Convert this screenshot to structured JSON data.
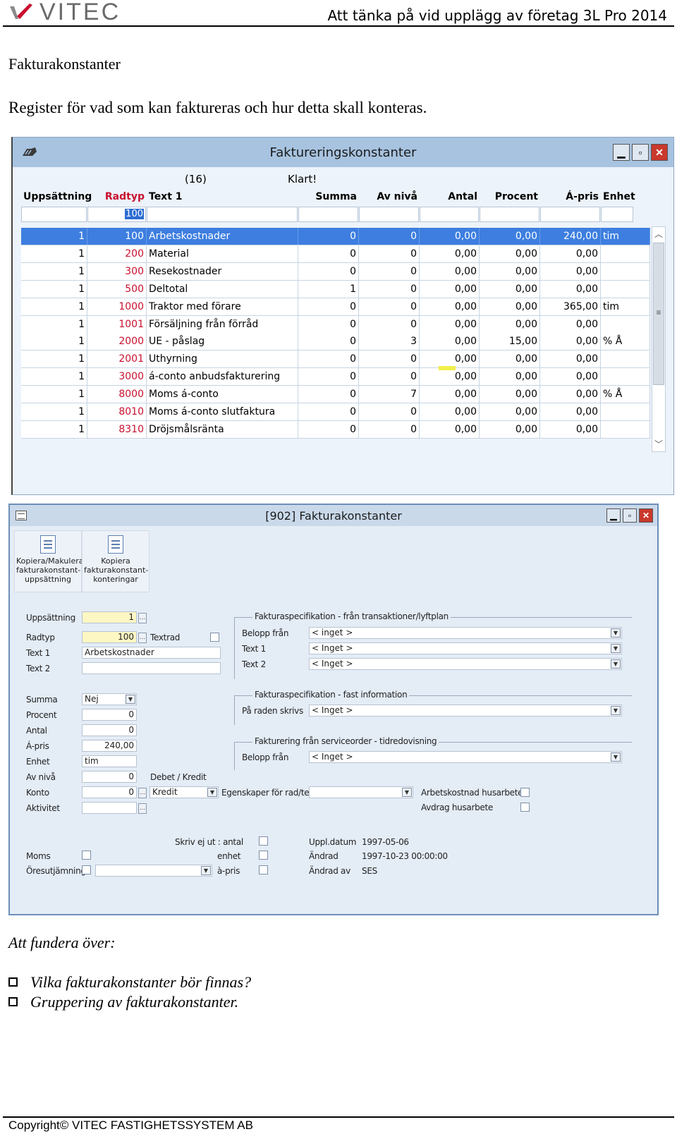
{
  "document": {
    "logo_text": "VITEC",
    "header_title": "Att tänka på vid upplägg av företag 3L Pro 2014",
    "section_title": "Fakturakonstanter",
    "section_description": "Register för vad som kan faktureras och hur detta skall konteras.",
    "ponder_heading": "Att fundera över:",
    "bullets": [
      "Vilka fakturakonstanter bör finnas?",
      "Gruppering av fakturakonstanter."
    ],
    "footer": "Copyright© VITEC FASTIGHETSSYSTEM AB"
  },
  "window1": {
    "title": "Faktureringskonstanter",
    "record_count": "(16)",
    "status": "Klart!",
    "columns": [
      "Uppsättning",
      "Radtyp",
      "Text 1",
      "Summa",
      "Av nivå",
      "Antal",
      "Procent",
      "Á-pris",
      "Enhet"
    ],
    "filter_value": "100",
    "rows": [
      [
        "1",
        "100",
        "Arbetskostnader",
        "0",
        "0",
        "0,00",
        "0,00",
        "240,00",
        "tim"
      ],
      [
        "1",
        "200",
        "Material",
        "0",
        "0",
        "0,00",
        "0,00",
        "0,00",
        ""
      ],
      [
        "1",
        "300",
        "Resekostnader",
        "0",
        "0",
        "0,00",
        "0,00",
        "0,00",
        ""
      ],
      [
        "1",
        "500",
        "Deltotal",
        "1",
        "0",
        "0,00",
        "0,00",
        "0,00",
        ""
      ],
      [
        "1",
        "1000",
        "Traktor med förare",
        "0",
        "0",
        "0,00",
        "0,00",
        "365,00",
        "tim"
      ],
      [
        "1",
        "1001",
        "Försäljning från förråd",
        "0",
        "0",
        "0,00",
        "0,00",
        "0,00",
        ""
      ],
      [
        "1",
        "2000",
        "UE - påslag",
        "0",
        "3",
        "0,00",
        "15,00",
        "0,00",
        "% Å"
      ],
      [
        "1",
        "2001",
        "Uthyrning",
        "0",
        "0",
        "0,00",
        "0,00",
        "0,00",
        ""
      ],
      [
        "1",
        "3000",
        "á-conto anbudsfakturering",
        "0",
        "0",
        "0,00",
        "0,00",
        "0,00",
        ""
      ],
      [
        "1",
        "8000",
        "Moms á-conto",
        "0",
        "7",
        "0,00",
        "0,00",
        "0,00",
        "% Å"
      ],
      [
        "1",
        "8010",
        "Moms á-conto slutfaktura",
        "0",
        "0",
        "0,00",
        "0,00",
        "0,00",
        ""
      ],
      [
        "1",
        "8310",
        "Dröjsmålsränta",
        "0",
        "0",
        "0,00",
        "0,00",
        "0,00",
        ""
      ]
    ]
  },
  "window2": {
    "title": "[902]  Fakturakonstanter",
    "toolbar": {
      "copy_delete_label": "Kopiera/Makulera fakturakonstant-uppsättning",
      "copy_postings_label": "Kopiera fakturakonstant-konteringar"
    },
    "fields": {
      "uppsattning_label": "Uppsättning",
      "uppsattning_value": "1",
      "radtyp_label": "Radtyp",
      "radtyp_value": "100",
      "textrad_label": "Textrad",
      "text1_label": "Text 1",
      "text1_value": "Arbetskostnader",
      "text2_label": "Text 2",
      "text2_value": "",
      "summa_label": "Summa",
      "summa_value": "Nej",
      "procent_label": "Procent",
      "procent_value": "0",
      "antal_label": "Antal",
      "antal_value": "0",
      "apris_label": "Á-pris",
      "apris_value": "240,00",
      "enhet_label": "Enhet",
      "enhet_value": "tim",
      "avniva_label": "Av nivå",
      "avniva_value": "0",
      "debet_kredit_label": "Debet / Kredit",
      "konto_label": "Konto",
      "konto_value": "0",
      "kredit_value": "Kredit",
      "egenskaper_label": "Egenskaper för rad/text",
      "aktivitet_label": "Aktivitet",
      "arbetskostnad_label": "Arbetskostnad husarbete",
      "avdrag_label": "Avdrag husarbete"
    },
    "group1": {
      "title": "Fakturaspecifikation - från transaktioner/lyftplan",
      "belopp_label": "Belopp från",
      "belopp_value": "< inget >",
      "text1_label": "Text 1",
      "text1_value": "< Inget >",
      "text2_label": "Text 2",
      "text2_value": "< Inget >"
    },
    "group2": {
      "title": "Fakturaspecifikation - fast information",
      "paraden_label": "På raden skrivs",
      "paraden_value": "< Inget >"
    },
    "group3": {
      "title": "Fakturering från serviceorder - tidredovisning",
      "belopp_label": "Belopp från",
      "belopp_value": "< Inget >"
    },
    "bottom": {
      "skriv_ej_label": "Skriv ej ut : antal",
      "enhet_label": "enhet",
      "apris_label": "à-pris",
      "moms_label": "Moms",
      "oresutjamning_label": "Öresutjämning",
      "uppl_datum_label": "Uppl.datum",
      "uppl_datum_value": "1997-05-06",
      "andrad_label": "Ändrad",
      "andrad_value": "1997-10-23 00:00:00",
      "andrad_av_label": "Ändrad av",
      "andrad_av_value": "SES"
    }
  },
  "colors": {
    "titlebar": "#a7c3e0",
    "selected_row": "#3d7ee0",
    "radtyp_red": "#c8102e",
    "required_field_yellow": "#fdf7c3",
    "close_button": "#c9392c"
  }
}
